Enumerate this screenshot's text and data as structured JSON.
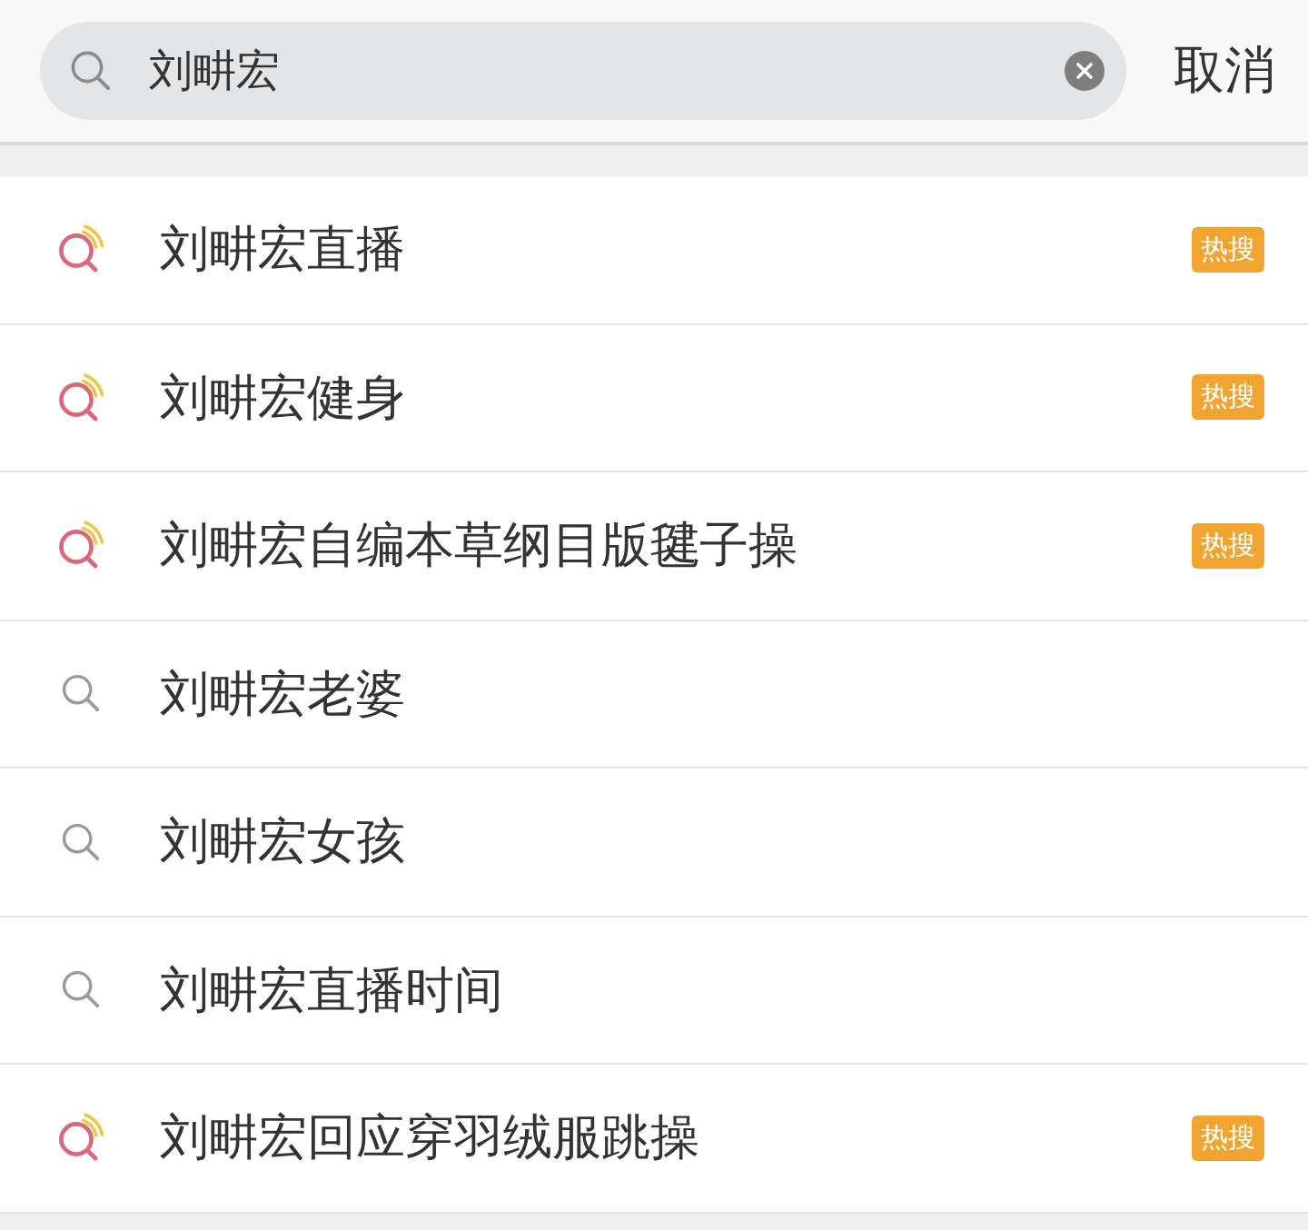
{
  "search": {
    "value": "刘畊宏",
    "cancel": "取消"
  },
  "suggestions": [
    {
      "kind": "hot",
      "text": "刘畊宏直播",
      "badge": "热搜"
    },
    {
      "kind": "hot",
      "text": "刘畊宏健身",
      "badge": "热搜"
    },
    {
      "kind": "hot",
      "text": "刘畊宏自编本草纲目版毽子操",
      "badge": "热搜"
    },
    {
      "kind": "plain",
      "text": "刘畊宏老婆"
    },
    {
      "kind": "plain",
      "text": "刘畊宏女孩"
    },
    {
      "kind": "plain",
      "text": "刘畊宏直播时间"
    },
    {
      "kind": "hot",
      "text": "刘畊宏回应穿羽绒服跳操",
      "badge": "热搜"
    }
  ]
}
